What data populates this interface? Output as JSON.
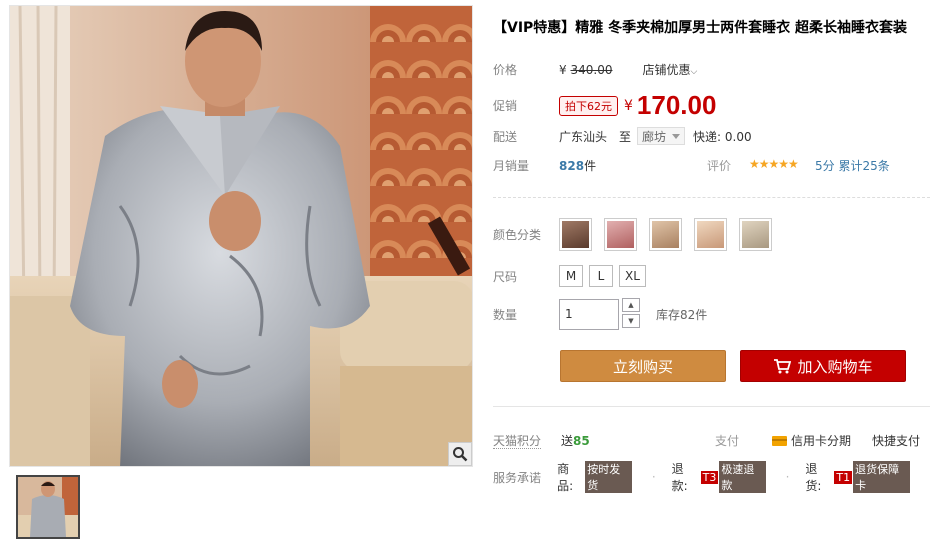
{
  "product": {
    "title": "【VIP特惠】精雅 冬季夹棉加厚男士两件套睡衣 超柔长袖睡衣套装"
  },
  "price": {
    "label": "价格",
    "currency": "¥",
    "original": "340.00",
    "shop_promo": "店铺优惠",
    "chevron": "⌵"
  },
  "promo": {
    "label": "促销",
    "badge": "拍下62元",
    "currency": "¥",
    "value": "170.00"
  },
  "shipping": {
    "label": "配送",
    "from": "广东汕头",
    "to_word": "至",
    "destination": "廊坊",
    "fee": "快递: 0.00"
  },
  "sales": {
    "label": "月销量",
    "count": "828",
    "unit": "件",
    "rating_label": "评价",
    "stars": "★★★★★",
    "score": "5分",
    "total_reviews": "累计25条"
  },
  "color": {
    "label": "颜色分类",
    "swatches": [
      "#8a6a5a",
      "#c98a8a",
      "#c6a48a",
      "#d9b49a",
      "#c8b8a0"
    ]
  },
  "size": {
    "label": "尺码",
    "options": [
      "M",
      "L",
      "XL"
    ]
  },
  "quantity": {
    "label": "数量",
    "value": "1",
    "up": "▲",
    "down": "▼",
    "stock": "库存82件"
  },
  "actions": {
    "buy_now": "立刻购买",
    "add_to_cart": "加入购物车"
  },
  "points": {
    "label": "天猫积分",
    "prefix": "送",
    "value": "85",
    "pay_label": "支付",
    "credit": "信用卡分期",
    "quick_pay": "快捷支付"
  },
  "service": {
    "label": "服务承诺",
    "items": [
      {
        "name": "商品:",
        "code": "",
        "tag": "按时发货"
      },
      {
        "name": "退款:",
        "code": "T3",
        "tag": "极速退款"
      },
      {
        "name": "退货:",
        "code": "T1",
        "tag": "退货保障卡"
      }
    ]
  },
  "colors": {
    "price_red": "#c40000",
    "buy_button": "#cf8b40",
    "cart_button": "#c40000"
  }
}
